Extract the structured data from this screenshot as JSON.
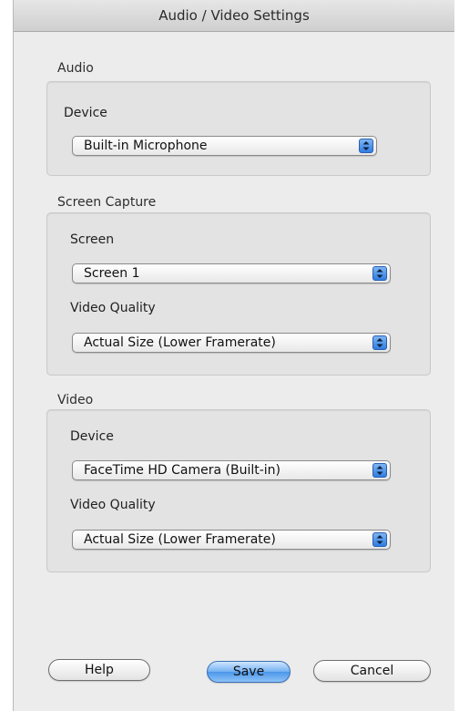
{
  "window": {
    "title": "Audio / Video Settings"
  },
  "audio": {
    "section_label": "Audio",
    "device_label": "Device",
    "device_value": "Built-in Microphone"
  },
  "screen_capture": {
    "section_label": "Screen Capture",
    "screen_label": "Screen",
    "screen_value": "Screen 1",
    "quality_label": "Video Quality",
    "quality_value": "Actual Size (Lower Framerate)"
  },
  "video": {
    "section_label": "Video",
    "device_label": "Device",
    "device_value": "FaceTime HD Camera (Built-in)",
    "quality_label": "Video Quality",
    "quality_value": "Actual Size (Lower Framerate)"
  },
  "buttons": {
    "help": "Help",
    "save": "Save",
    "cancel": "Cancel"
  },
  "colors": {
    "accent": "#4c97ea",
    "window_bg": "#ececec",
    "group_bg": "#e3e3e3"
  }
}
